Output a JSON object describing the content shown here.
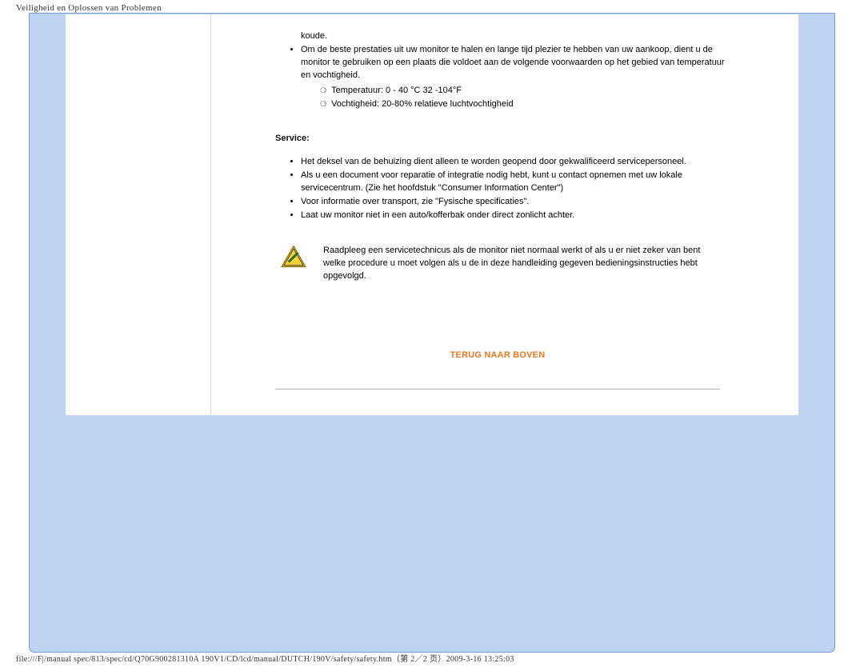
{
  "page": {
    "header_title": "Veiligheid en Oplossen van Problemen",
    "footer_path": "file:///F|/manual spec/813/spec/cd/Q70G900281310A 190V1/CD/lcd/manual/DUTCH/190V/safety/safety.htm（第 2／2 页）2009-3-16 13:25:03"
  },
  "content": {
    "koude_tail": "koude.",
    "bullet_conditions": "Om de beste prestaties uit uw monitor te halen en lange tijd plezier te hebben van uw aankoop, dient u de monitor te gebruiken op een plaats die voldoet aan de volgende voorwaarden op het gebied van temperatuur en vochtigheid.",
    "sub_temp": "Temperatuur: 0 - 40 °C 32 -104°F",
    "sub_humidity": "Vochtigheid: 20-80% relatieve luchtvochtigheid"
  },
  "service": {
    "heading": "Service:",
    "items": [
      "Het deksel van de behuizing dient alleen te worden geopend door gekwalificeerd servicepersoneel.",
      "Als u een document voor reparatie of integratie nodig hebt, kunt u contact opnemen met uw lokale servicecentrum. (Zie het hoofdstuk \"Consumer Information Center\")",
      "Voor informatie over transport, zie \"Fysische specificaties\".",
      "Laat uw monitor niet in een auto/kofferbak onder direct zonlicht achter."
    ],
    "warning_text": "Raadpleeg een servicetechnicus als de monitor niet normaal werkt of als u er niet zeker van bent welke procedure u moet volgen als u de in deze handleiding gegeven bedieningsinstructies hebt opgevolgd."
  },
  "links": {
    "back_to_top": "TERUG NAAR BOVEN"
  }
}
